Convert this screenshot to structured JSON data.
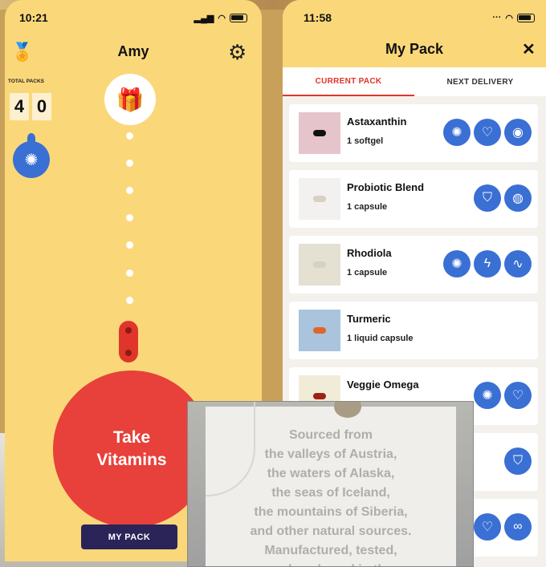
{
  "left_phone": {
    "time": "10:21",
    "user_name": "Amy",
    "total_packs_label": "TOTAL PACKS",
    "total_packs_digits": [
      "4",
      "0"
    ],
    "take_vitamins_line1": "Take",
    "take_vitamins_line2": "Vitamins",
    "my_pack_button": "MY PACK",
    "icons": {
      "award": "award-icon",
      "settings": "gear-icon",
      "brain": "brain-icon",
      "gift": "gift-icon"
    }
  },
  "right_phone": {
    "time": "11:58",
    "title": "My Pack",
    "close_symbol": "✕",
    "tabs": [
      {
        "label": "CURRENT PACK",
        "active": true
      },
      {
        "label": "NEXT DELIVERY",
        "active": false
      }
    ],
    "products": [
      {
        "name": "Astaxanthin",
        "dose": "1 softgel",
        "thumb_color": "#e6c4cc",
        "icons": [
          "brain-icon",
          "heart-icon",
          "eye-icon"
        ]
      },
      {
        "name": "Probiotic Blend",
        "dose": "1 capsule",
        "thumb_color": "#f2f1ef",
        "icons": [
          "shield-icon",
          "apple-icon"
        ]
      },
      {
        "name": "Rhodiola",
        "dose": "1 capsule",
        "thumb_color": "#e4e0d2",
        "icons": [
          "brain-icon",
          "bolt-icon",
          "wave-icon"
        ]
      },
      {
        "name": "Turmeric",
        "dose": "1 liquid capsule",
        "thumb_color": "#a9c4dc",
        "icons": []
      },
      {
        "name": "Veggie Omega",
        "dose": "",
        "thumb_color": "#f1ecd8",
        "icons": [
          "brain-icon",
          "heart-icon"
        ]
      },
      {
        "name": "",
        "dose": "",
        "thumb_color": "#ffffff",
        "icons": [
          "shield-icon"
        ]
      },
      {
        "name": "",
        "dose": "",
        "thumb_color": "#ffffff",
        "icons": [
          "heart-icon",
          "bone-icon"
        ]
      }
    ]
  },
  "photo_text": [
    "Sourced from",
    "the valleys of Austria,",
    "the waters of Alaska,",
    "the seas of Iceland,",
    "the mountains of Siberia,",
    "and other natural sources.",
    "Manufactured, tested,",
    "and packaged in the"
  ],
  "colors": {
    "yellow": "#fad87a",
    "red": "#e8403a",
    "blue": "#3a6fd4",
    "navy": "#2b2459"
  }
}
